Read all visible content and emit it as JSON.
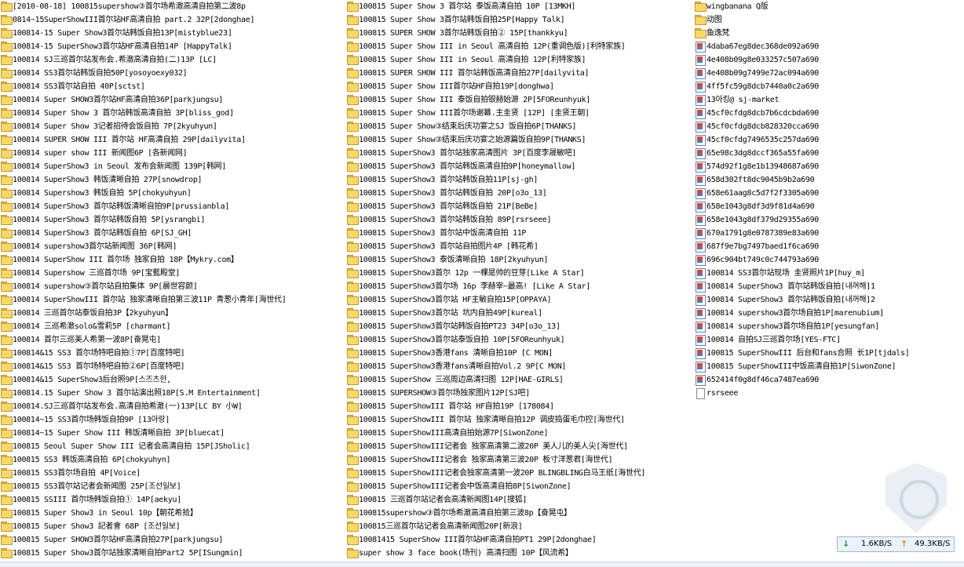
{
  "explorer": {
    "columns": [
      [
        {
          "type": "folder",
          "name": "[2010-08-18] 100815supershow③首尔场希澈高清自拍第二波8p"
        },
        {
          "type": "folder",
          "name": "0814~15SuperShowIII首尔站HF高清自拍 part.2 32P[2donghae]"
        },
        {
          "type": "folder",
          "name": "100814-15 Super Show3首尔站韩饭自拍13P[mistyblue23]"
        },
        {
          "type": "folder",
          "name": "100814-15 SuperShow3首尔站HF高清自拍14P [HappyTalk]"
        },
        {
          "type": "folder",
          "name": "100814 SJ三巡首尔站发布会.希澈高清自拍(二)13P [LC]"
        },
        {
          "type": "folder",
          "name": "100814 SS3首尔站韩饭自拍50P[yosoyoexy032]"
        },
        {
          "type": "folder",
          "name": "100814 SS3首尔站自拍 40P[sctst]"
        },
        {
          "type": "folder",
          "name": "100814 Super SHOW3首尔站HF高清自拍36P[parkjungsu]"
        },
        {
          "type": "folder",
          "name": "100814 Super Show 3 首尔站韩饭高清自拍 3P[bliss_god]"
        },
        {
          "type": "folder",
          "name": "100814 Super Show 3记者招待会饭自拍 7P[2kyuhyun]"
        },
        {
          "type": "folder",
          "name": "100814 SUPER SHOW III 首尔站 HF高清自拍 29P[dailyvita]"
        },
        {
          "type": "folder",
          "name": "100814 super show III 新闻图6P [各新闻网]"
        },
        {
          "type": "folder",
          "name": "100814 SuperShow3 in Seoul 发布会新闻图 139P[韩网]"
        },
        {
          "type": "folder",
          "name": "100814 SuperShow3 韩饭清晰自拍 27P[snowdrop]"
        },
        {
          "type": "folder",
          "name": "100814 Supershow3 韩饭自拍 5P[chokyuhyun]"
        },
        {
          "type": "folder",
          "name": "100814 SuperShow3 首尔站韩饭清晰自拍9P[prussianbla]"
        },
        {
          "type": "folder",
          "name": "100814 SuperShow3 首尔站韩饭自拍 5P[ysrangbi]"
        },
        {
          "type": "folder",
          "name": "100814 SuperShow3 首尔站韩饭自拍 6P[SJ_GH]"
        },
        {
          "type": "folder",
          "name": "100814 supershow3首尔站新闻图 36P[韩网]"
        },
        {
          "type": "folder",
          "name": "100814 SuperShow III 首尔场 独家自拍 18P【Mykry.com】"
        },
        {
          "type": "folder",
          "name": "100814 Supershow 三巡首尔场 9P[宝藍殿堂]"
        },
        {
          "type": "folder",
          "name": "100814 supershow③首尔站自拍集体 9P[晨世容颜]"
        },
        {
          "type": "folder",
          "name": "100814 SuperShowIII 首尔站 独家清晰自拍第三波11P 青葱小青年[海世代]"
        },
        {
          "type": "folder",
          "name": "100814 三巡首尔站泰饭自拍3P【2kyuhyun】"
        },
        {
          "type": "folder",
          "name": "100814 三巡希澈solo&雪莉5P [charmant]"
        },
        {
          "type": "folder",
          "name": "100814 首尔三巡美人希第一波8P[奋晃屯]"
        },
        {
          "type": "folder",
          "name": "100814&15 SS3 首尔场特吧自拍①7P[百度特吧]"
        },
        {
          "type": "folder",
          "name": "100814&15 SS3 首尔场特吧自拍②6P[百度特吧]"
        },
        {
          "type": "folder",
          "name": "100814&15 SuperShow3后台照9P[스즈츠한,"
        },
        {
          "type": "folder",
          "name": "100814.15 Super Show 3 首尔站演出照18P[S.M Entertainment]"
        },
        {
          "type": "folder",
          "name": "100814.SJ三巡首尔站发布会.高清自拍希澈(一)13P[LC BY 小W]"
        },
        {
          "type": "folder",
          "name": "100814~15 SS3首尔场韩饭自拍9P [13아랑]"
        },
        {
          "type": "folder",
          "name": "100814~15 Super Show III 韩饭清晰自拍 3P[bluecat]"
        },
        {
          "type": "folder",
          "name": "100815 Seoul Super Show III 记者会高清自拍 15P[JSholic]"
        },
        {
          "type": "folder",
          "name": "100815 SS3 韩饭高清自拍 6P[chokyuhyn]"
        },
        {
          "type": "folder",
          "name": "100815 SS3首尔场自拍 4P[Voice]"
        },
        {
          "type": "folder",
          "name": "100815 SS3首尔站记者会新闻图 25P[조선일보]"
        },
        {
          "type": "folder",
          "name": "100815 SSIII 首尔场韩饭自拍① 14P[aekyu]"
        },
        {
          "type": "folder",
          "name": "100815 Super Show3 in Seoul 10p【朝花希拾】"
        },
        {
          "type": "folder",
          "name": "100815 Super Show3 記者會 68P [조선일보]"
        },
        {
          "type": "folder",
          "name": "100815 Super SHOW3首尔站HF高清自拍27P[parkjungsu]"
        },
        {
          "type": "folder",
          "name": "100815 Super Show3首尔站独家清晰自拍Part2 5P[ISungmin]"
        }
      ],
      [
        {
          "type": "folder",
          "name": "100815 Super Show 3 首尔站 泰饭高清自拍 10P [13MKH]"
        },
        {
          "type": "folder",
          "name": "100815 Super Show 3首尔站韩饭自拍25P[Happy Talk]"
        },
        {
          "type": "folder",
          "name": "100815 SUPER SHOW 3首尔站韩饭自拍② 15P[thankkyu]"
        },
        {
          "type": "folder",
          "name": "100815 Super Show III in Seoul 高清自拍 12P(重调色版)[利特家族]"
        },
        {
          "type": "folder",
          "name": "100815 Super Show III in Seoul 高清自拍 12P[利特家族]"
        },
        {
          "type": "folder",
          "name": "100815 SUPER SHOW III 首尔站韩饭高清自拍27P[dailyvita]"
        },
        {
          "type": "folder",
          "name": "100815 Super Show III首尔站HF自拍19P[donghwa]"
        },
        {
          "type": "folder",
          "name": "100815 Super Show III 泰饭自拍银赫始源 2P[5FOReunhyuk]"
        },
        {
          "type": "folder",
          "name": "100815 Super Show III首尔场谢幕.主圭贤 [12P] [圭贤王朝]"
        },
        {
          "type": "folder",
          "name": "100815 Super Show③结束后庆功宴之SJ 饭自拍6P[THANKS]"
        },
        {
          "type": "folder",
          "name": "100815 Super Show③结束后庆功宴之始源篇饭自拍9P[THANKS]"
        },
        {
          "type": "folder",
          "name": "100815 SuperShow3 首尔站独家高清图片 3P[百度李晟敏吧]"
        },
        {
          "type": "folder",
          "name": "100815 SuperShow3 首尔站韩饭高清自拍9P[honeymallow]"
        },
        {
          "type": "folder",
          "name": "100815 SuperShow3 首尔站韩饭自拍11P[sj-gh]"
        },
        {
          "type": "folder",
          "name": "100815 SuperShow3 首尔站韩饭自拍 20P[o3o_13]"
        },
        {
          "type": "folder",
          "name": "100815 SuperShow3 首尔站韩饭自拍 21P[BeBe]"
        },
        {
          "type": "folder",
          "name": "100815 SuperShow3 首尔站韩饭自拍 89P[rsrseee]"
        },
        {
          "type": "folder",
          "name": "100815 SuperShow3 首尔站中饭高清自拍 11P"
        },
        {
          "type": "folder",
          "name": "100815 SuperShow3 首尔站自拍图片4P [韩花希]"
        },
        {
          "type": "folder",
          "name": "100815 SuperShow3 泰饭清晰自拍 18P[2kyuhyun]"
        },
        {
          "type": "folder",
          "name": "100815 SuperShow3首尔 12p 一棵是帅的豆芽[Like A Star]"
        },
        {
          "type": "folder",
          "name": "100815 SuperShow3首尔场 16p 李赫宰~最高! [Like A Star]"
        },
        {
          "type": "folder",
          "name": "100815 SuperShow3首尔站 HF主敏自拍15P[OPPAYA]"
        },
        {
          "type": "folder",
          "name": "100815 SuperShow3首尔站 坑内自拍49P[kureal]"
        },
        {
          "type": "folder",
          "name": "100815 SuperShow3首尔站韩饭自拍PT23 34P[o3o_13]"
        },
        {
          "type": "folder",
          "name": "100815 SuperShow3首尔站泰饭自拍 10P[5FOReunhyuk]"
        },
        {
          "type": "folder",
          "name": "100815 SuperShow3香港fans 清晰自拍10P [C MON]"
        },
        {
          "type": "folder",
          "name": "100815 SuperShow3香港fans清晰自拍Vol.2 9P[C MON]"
        },
        {
          "type": "folder",
          "name": "100815 SuperShow 三巡周边高清扫图 12P[HAE-GIRLS]"
        },
        {
          "type": "folder",
          "name": "100815 SUPERSHOW③首尔场独家图片12P[SJ吧]"
        },
        {
          "type": "folder",
          "name": "100815 SuperShowIII 首尔站 HF自拍19P [178084]"
        },
        {
          "type": "folder",
          "name": "100815 SuperShowIII 首尔站 独家清晰自拍12P 调皮捣蛋毛巾控[海世代]"
        },
        {
          "type": "folder",
          "name": "100815 SuperShowIII高清自拍始源7P[SiwonZone]"
        },
        {
          "type": "folder",
          "name": "100815 SuperShowIII记者会 独家高清第二波20P 美人儿的美人尖[海世代]"
        },
        {
          "type": "folder",
          "name": "100815 SuperShowIII记者会 独家高清第三波20P 板寸洋葱君[海世代]"
        },
        {
          "type": "folder",
          "name": "100815 SuperShowIII记者会独家高清第一波20P BLINGBLING白马王纸[海世代]"
        },
        {
          "type": "folder",
          "name": "100815 SuperShowIII记者会中饭高清自拍8P[SiwonZone]"
        },
        {
          "type": "folder",
          "name": "100815 三巡首尔站记者会高清新闻图14P[搜狐]"
        },
        {
          "type": "folder",
          "name": "100815supershow③首尔场希澈高清自拍第三波8p【奋晃屯】"
        },
        {
          "type": "folder",
          "name": "100815三巡首尔站记者会高清新闻图20P[新浪]"
        },
        {
          "type": "folder",
          "name": "10081415 SuperShow III首尔站HF高清自拍PT1 29P[2donghae]"
        },
        {
          "type": "folder",
          "name": "super show 3 face book(场刊) 高清扫图 10P【风流希】"
        }
      ],
      [
        {
          "type": "folder",
          "name": "wingbanana  Q版"
        },
        {
          "type": "folder",
          "name": "动图"
        },
        {
          "type": "folder",
          "name": "鱼逸梵"
        },
        {
          "type": "image",
          "name": "4daba67eg8dec368de092a690"
        },
        {
          "type": "image",
          "name": "4e408b09g8e033257c507a690"
        },
        {
          "type": "image",
          "name": "4e408b09g7499e72ac094a690"
        },
        {
          "type": "image",
          "name": "4ff5fc59g8dcb7440a0c2a690"
        },
        {
          "type": "image",
          "name": "13아킹@ sj-market"
        },
        {
          "type": "image",
          "name": "45cf0cfdg8dcb7b6cdcbda690"
        },
        {
          "type": "image",
          "name": "45cf0cfdg8dcb828320cca690"
        },
        {
          "type": "image",
          "name": "45cf0cfdg7496535c257da690"
        },
        {
          "type": "image",
          "name": "65e98c3dg8dccf365a55fa690"
        },
        {
          "type": "image",
          "name": "574d92f1g8e1b13948687a690"
        },
        {
          "type": "image",
          "name": "658d302ft8dc9045b9b2a690"
        },
        {
          "type": "image",
          "name": "658e61aag8c5d7f2f3305a690"
        },
        {
          "type": "image",
          "name": "658e1043g8df3d9f81d4a690"
        },
        {
          "type": "image",
          "name": "658e1043g8df379d29355a690"
        },
        {
          "type": "image",
          "name": "670a1791g8e0787389e83a690"
        },
        {
          "type": "image",
          "name": "687f9e7bg7497baed1f6ca690"
        },
        {
          "type": "image",
          "name": "696c904bt749c0c744793a690"
        },
        {
          "type": "image",
          "name": "100814 SS3首尔站现场 圭贤照片1P[huy_m]"
        },
        {
          "type": "image",
          "name": "100814 SuperShow3 首尔站韩饭自拍[내꺼해]1"
        },
        {
          "type": "image",
          "name": "100814 SuperShow3 首尔站韩饭自拍[내꺼해]2"
        },
        {
          "type": "image",
          "name": "100814 supershow3首尔场自拍1P[marenubium]"
        },
        {
          "type": "image",
          "name": "100814 supershow3首尔场自拍1P[yesungfan]"
        },
        {
          "type": "image",
          "name": "100814 自拍SJ三巡首尔场[YES-FTC]"
        },
        {
          "type": "image",
          "name": "100815 SuperShowIII 后台和fans合照 长1P[tjdals]"
        },
        {
          "type": "image",
          "name": "100815 SuperShowIII中饭高清自拍1P[SiwonZone]"
        },
        {
          "type": "image",
          "name": "652414f0g8df46ca7487ea690"
        },
        {
          "type": "file",
          "name": "rsrseee"
        }
      ]
    ]
  },
  "status": {
    "download_speed": "1.6KB/S",
    "upload_speed": "49.3KB/S",
    "down_arrow": "↓",
    "up_arrow": "↑"
  }
}
